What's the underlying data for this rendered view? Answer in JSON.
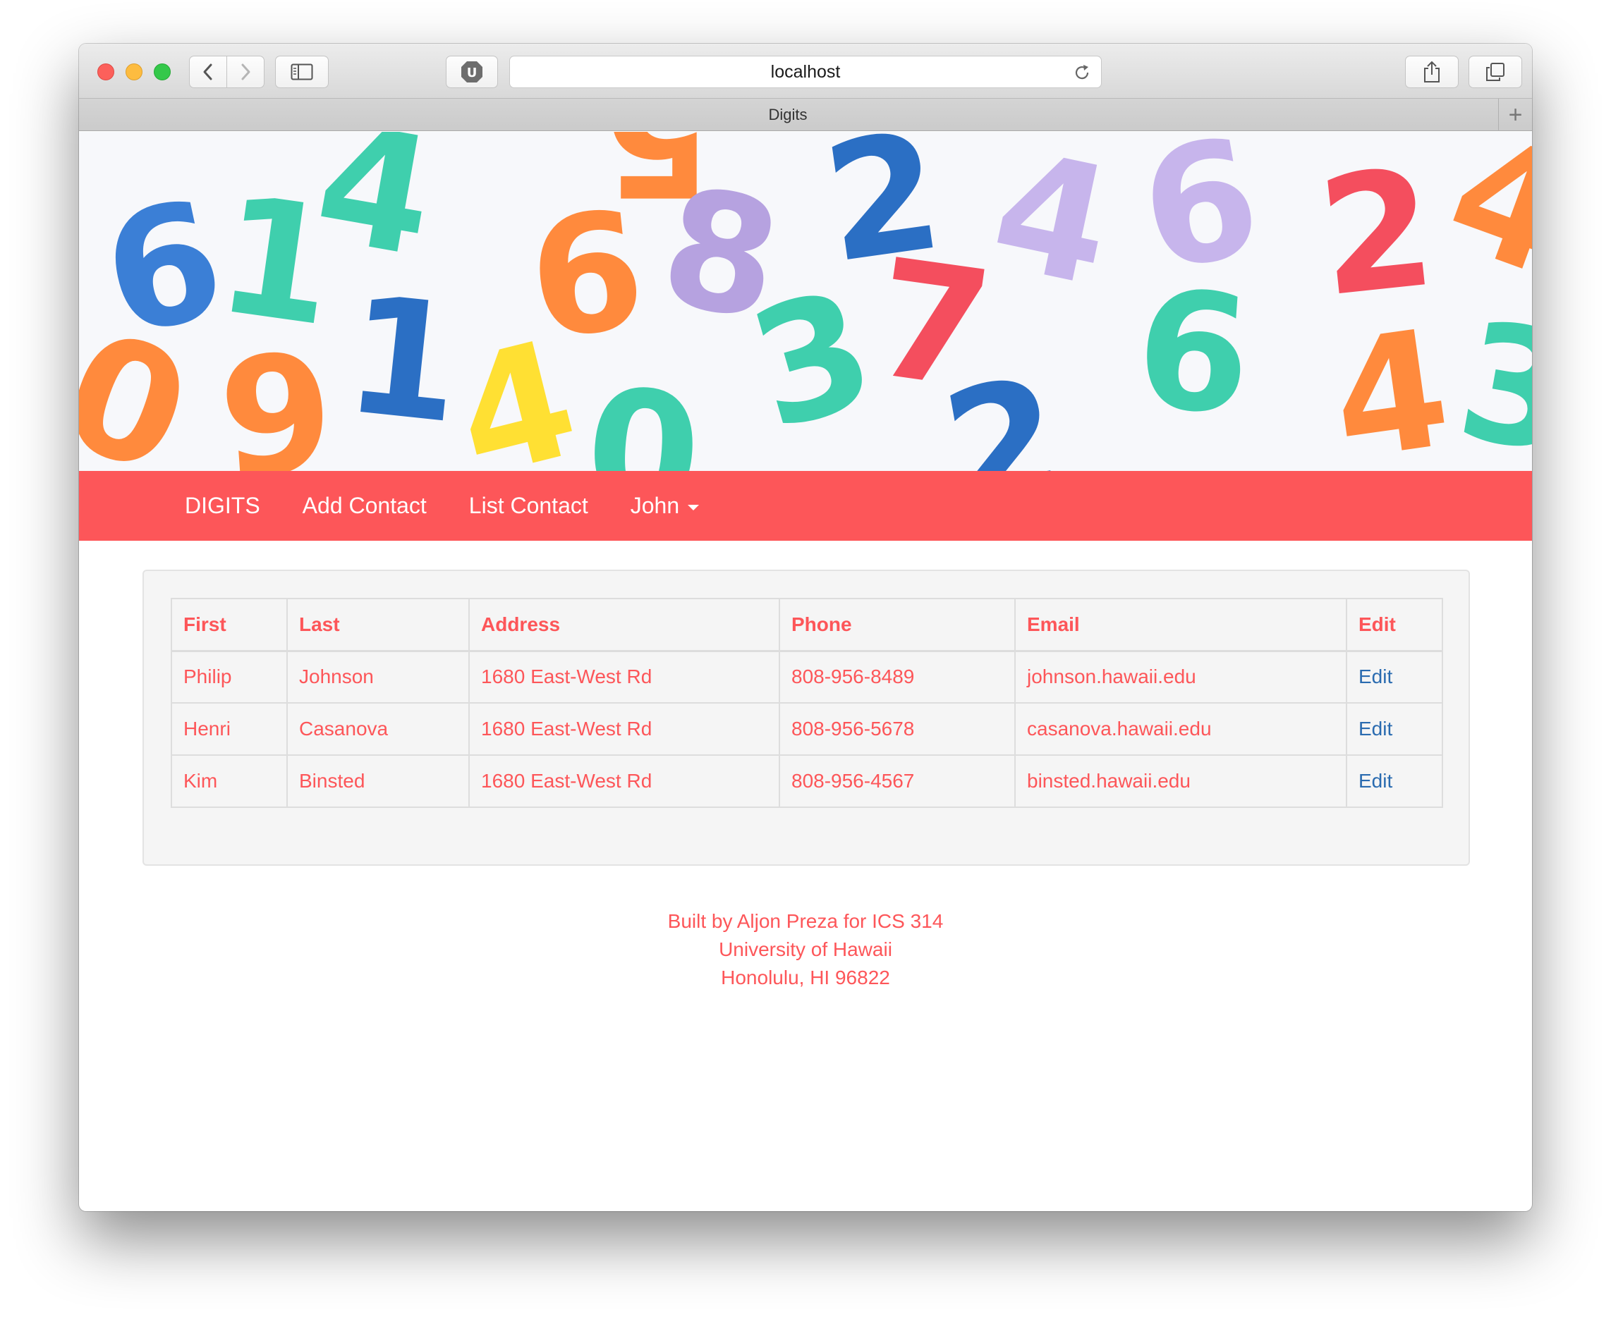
{
  "browser": {
    "url": "localhost",
    "tab_title": "Digits",
    "new_tab_label": "+"
  },
  "navbar": {
    "brand": "DIGITS",
    "links": [
      "Add Contact",
      "List Contact"
    ],
    "user": "John"
  },
  "table": {
    "headers": [
      "First",
      "Last",
      "Address",
      "Phone",
      "Email",
      "Edit"
    ],
    "rows": [
      {
        "first": "Philip",
        "last": "Johnson",
        "address": "1680 East-West Rd",
        "phone": "808-956-8489",
        "email": "johnson.hawaii.edu",
        "edit": "Edit"
      },
      {
        "first": "Henri",
        "last": "Casanova",
        "address": "1680 East-West Rd",
        "phone": "808-956-5678",
        "email": "casanova.hawaii.edu",
        "edit": "Edit"
      },
      {
        "first": "Kim",
        "last": "Binsted",
        "address": "1680 East-West Rd",
        "phone": "808-956-4567",
        "email": "binsted.hawaii.edu",
        "edit": "Edit"
      }
    ]
  },
  "footer": {
    "line1": "Built by Aljon Preza for ICS 314",
    "line2": "University of Hawaii",
    "line3": "Honolulu, HI 96822"
  },
  "banner_digits": [
    "6",
    "1",
    "4",
    "5",
    "6",
    "8",
    "2",
    "4",
    "6",
    "2",
    "4",
    "1",
    "4",
    "0",
    "3",
    "7",
    "2",
    "6",
    "4",
    "0",
    "9",
    "3"
  ],
  "colors": {
    "accent": "#fd5659",
    "link_blue": "#2a6bb0"
  }
}
